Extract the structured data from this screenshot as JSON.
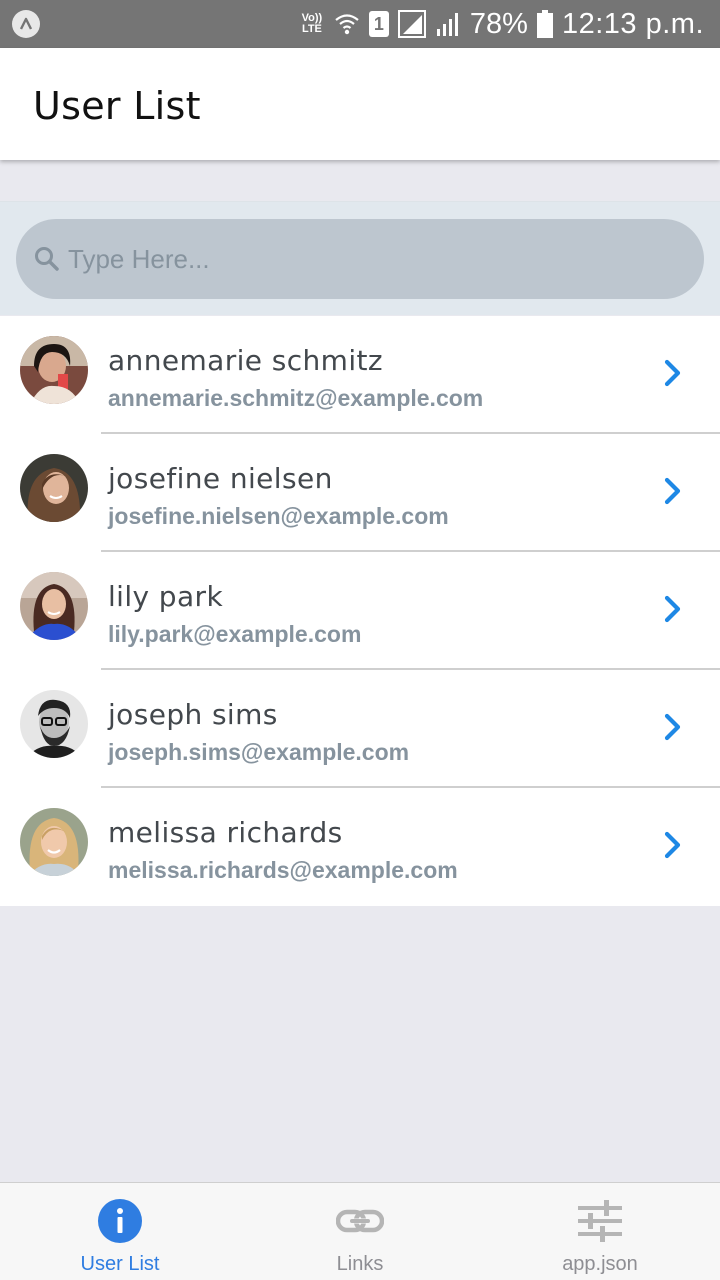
{
  "status_bar": {
    "volte_top": "Vo))",
    "volte_bottom": "LTE",
    "sim": "1",
    "battery": "78%",
    "time": "12:13 p.m."
  },
  "header": {
    "title": "User List"
  },
  "search": {
    "placeholder": "Type Here..."
  },
  "users": [
    {
      "name": "annemarie schmitz",
      "email": "annemarie.schmitz@example.com"
    },
    {
      "name": "josefine nielsen",
      "email": "josefine.nielsen@example.com"
    },
    {
      "name": "lily park",
      "email": "lily.park@example.com"
    },
    {
      "name": "joseph sims",
      "email": "joseph.sims@example.com"
    },
    {
      "name": "melissa richards",
      "email": "melissa.richards@example.com"
    }
  ],
  "tabs": [
    {
      "label": "User List",
      "icon": "info-icon",
      "active": true
    },
    {
      "label": "Links",
      "icon": "link-icon",
      "active": false
    },
    {
      "label": "app.json",
      "icon": "sliders-icon",
      "active": false
    }
  ],
  "colors": {
    "accent": "#2f7de1",
    "chevron": "#1e88e5",
    "name": "#43484d",
    "email": "#86939e"
  }
}
